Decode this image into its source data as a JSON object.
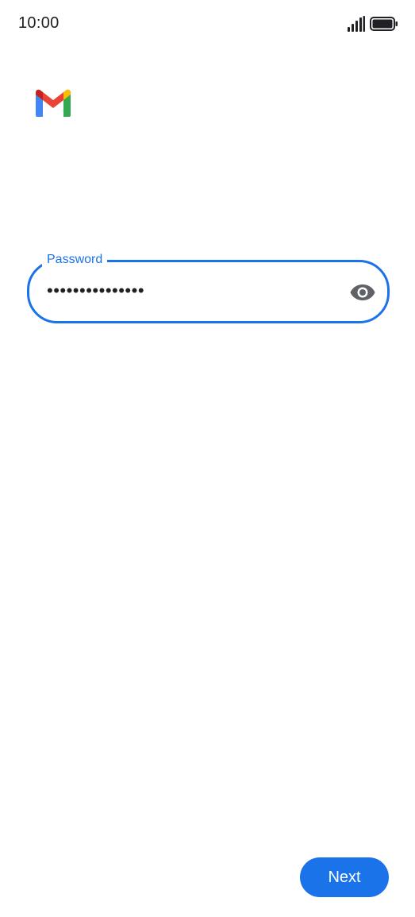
{
  "status_bar": {
    "time": "10:00",
    "signal_icon": "cellular-signal-icon",
    "battery_icon": "battery-full-icon"
  },
  "logo": {
    "icon": "gmail-logo-icon",
    "colors": {
      "red": "#EA4335",
      "blue": "#4285F4",
      "green": "#34A853",
      "yellow": "#FBBC04",
      "dark_red": "#C5221F"
    }
  },
  "password_field": {
    "label": "Password",
    "value": "•••••••••••••••",
    "toggle_icon": "eye-icon"
  },
  "next_button": {
    "label": "Next"
  },
  "colors": {
    "accent": "#1a73e8",
    "text": "#202124",
    "icon_gray": "#5f6368"
  }
}
